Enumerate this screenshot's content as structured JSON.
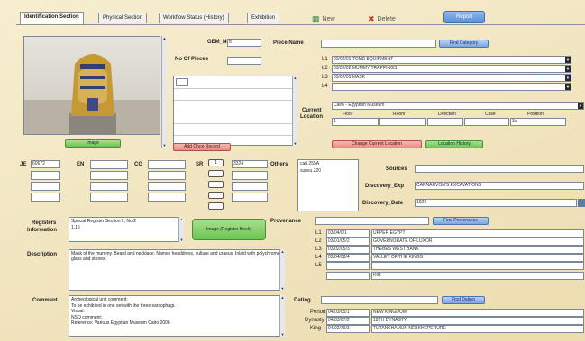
{
  "tabs": [
    "Identification Section",
    "Physical Section",
    "Workflow Status (History)",
    "Exhibition"
  ],
  "toolbar": {
    "new_label": "New",
    "delete_label": "Delete",
    "report_label": "Report"
  },
  "left": {
    "image_button": "Image",
    "add_once_button": "Add Once Record",
    "image_register_button": "Image (Register Book)"
  },
  "gem": {
    "label": "GEM_No",
    "value": "8",
    "pieces_label": "No Of Pieces"
  },
  "piece": {
    "label": "Piece Name",
    "find_category": "Find Category",
    "l_labels": [
      "L1",
      "L2",
      "L3",
      "L4"
    ],
    "l_values": [
      "03/02/01 TOMB EQUIPMENT",
      "03/02/02 MUMMY TRAPPINGS",
      "03/02/03 MASK",
      ""
    ]
  },
  "location": {
    "label_current": "Current",
    "label_location": "Location",
    "value": "Cairo - Egyptian Museum",
    "cols": [
      "Floor",
      "Room",
      "Direction",
      "Case",
      "Position"
    ],
    "vals": [
      "1",
      "",
      "",
      "",
      "3A"
    ],
    "change_button": "Change Current Location",
    "history_button": "Location History"
  },
  "numbers": {
    "je_label": "JE",
    "je_value": "60672",
    "en_label": "EN",
    "cg_label": "CG",
    "sr_label": "SR",
    "sr_small": "1",
    "sr_value": "3324",
    "others_label": "Others",
    "others_values": [
      "carl.255A",
      "sunsu.220"
    ]
  },
  "discovery": {
    "sources_label": "Sources",
    "exp_label": "Discovery_Exp",
    "exp_value": "CARNARVON'S EXCAVATIONS",
    "date_label": "Discovery_Date",
    "date_value": "1922"
  },
  "registers": {
    "label1": "Registers",
    "label2": "Information",
    "text": "Special Register Section I , No.2",
    "text2": "1.16"
  },
  "provenance": {
    "label": "Provenance",
    "find_button": "Find Provenance",
    "l_labels": [
      "L1",
      "L2",
      "L3",
      "L4",
      "L5",
      ""
    ],
    "codes": [
      "03/04/0/1",
      "03/01/05/2",
      "03/02/05/3",
      "03/04/08/4",
      "",
      ""
    ],
    "values": [
      "UPPER EGYPT",
      "GOVERNORATE OF LUXOR",
      "THEBES WEST BANK",
      "VALLEY OF THE KINGS",
      "",
      "K62"
    ]
  },
  "description": {
    "label": "Description",
    "text": "Mask of the mummy. Beard and necklace. Names headdress, vulture and uraeus. Inlaid with polychrome glass and stones."
  },
  "comment": {
    "label": "Comment",
    "lines": [
      "Archeological unit comment:",
      "To be exhibited in one set with the three sarcophagi.",
      "Visual:",
      "NSO comment:",
      "Reference: Various Egyptian Museum Cairo 2006"
    ]
  },
  "dating": {
    "label": "Dating",
    "find_button": "Find Dating",
    "rows": [
      {
        "label": "Period",
        "code": "04/03/05/1",
        "value": "NEW KINGDOM"
      },
      {
        "label": "Dynasty",
        "code": "04/03/07/2",
        "value": "18TH DYNASTY"
      },
      {
        "label": "King",
        "code": "04/02/79/3",
        "value": "TUTANKHAMUN NEBKHEPERURE"
      }
    ]
  },
  "colors": {
    "accent_blue": "#7da4e0",
    "green": "#6cc451",
    "red": "#e38f84",
    "background": "#f2e6c2"
  }
}
